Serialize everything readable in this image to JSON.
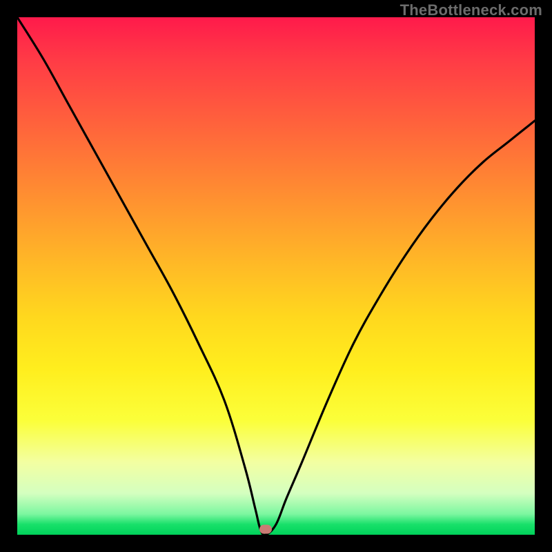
{
  "watermark": "TheBottleneck.com",
  "colors": {
    "frame_background": "#000000",
    "curve_stroke": "#000000",
    "marker_fill": "#c97b74",
    "watermark_text": "#6c6c6c"
  },
  "chart_data": {
    "type": "line",
    "title": "",
    "xlabel": "",
    "ylabel": "",
    "xlim": [
      0,
      100
    ],
    "ylim": [
      0,
      100
    ],
    "grid": false,
    "legend": false,
    "background_gradient_stops": [
      {
        "pos": 0.0,
        "color": "#ff1a4b"
      },
      {
        "pos": 0.08,
        "color": "#ff3a46"
      },
      {
        "pos": 0.18,
        "color": "#ff5a3e"
      },
      {
        "pos": 0.28,
        "color": "#ff7a36"
      },
      {
        "pos": 0.38,
        "color": "#ff9a2e"
      },
      {
        "pos": 0.48,
        "color": "#ffba26"
      },
      {
        "pos": 0.58,
        "color": "#ffd81e"
      },
      {
        "pos": 0.68,
        "color": "#ffee1e"
      },
      {
        "pos": 0.78,
        "color": "#fbff3a"
      },
      {
        "pos": 0.86,
        "color": "#f3ffa2"
      },
      {
        "pos": 0.92,
        "color": "#d4ffc0"
      },
      {
        "pos": 0.96,
        "color": "#7cf7a0"
      },
      {
        "pos": 0.98,
        "color": "#18e06a"
      },
      {
        "pos": 1.0,
        "color": "#00d25a"
      }
    ],
    "series": [
      {
        "name": "bottleneck-curve",
        "x": [
          0,
          5,
          10,
          15,
          20,
          25,
          30,
          35,
          40,
          44,
          46,
          47,
          48,
          50,
          52,
          55,
          60,
          65,
          70,
          75,
          80,
          85,
          90,
          95,
          100
        ],
        "y": [
          100,
          92,
          83,
          74,
          65,
          56,
          47,
          37,
          26,
          13,
          5,
          1,
          0,
          2,
          7,
          14,
          26,
          37,
          46,
          54,
          61,
          67,
          72,
          76,
          80
        ]
      }
    ],
    "optimal_point": {
      "x": 48,
      "y": 0
    }
  }
}
